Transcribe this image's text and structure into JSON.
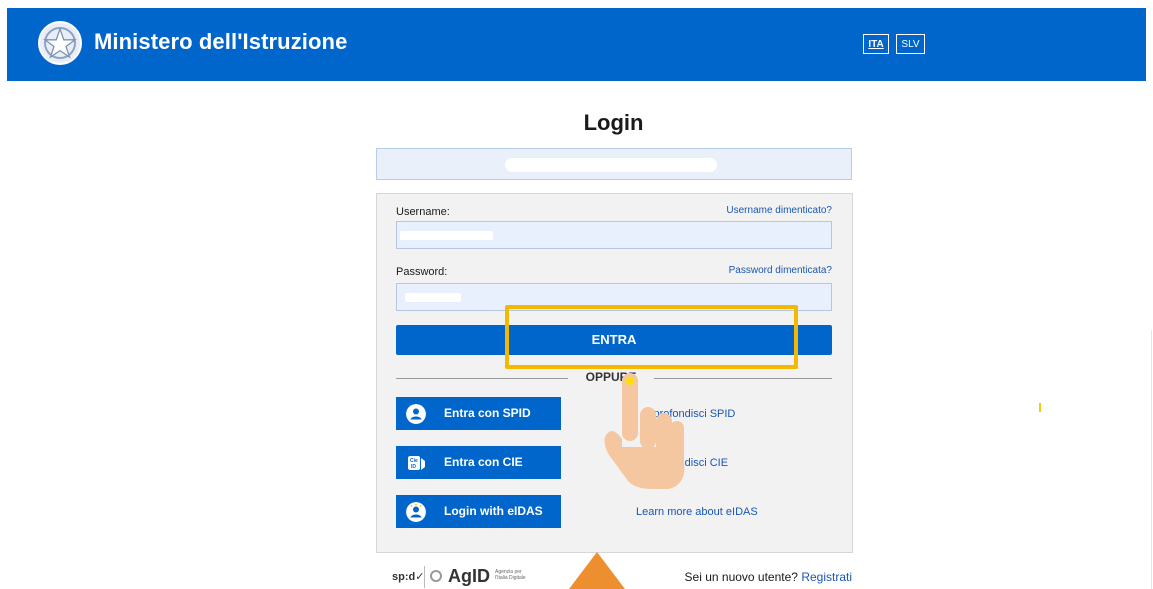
{
  "header": {
    "brand": "Ministero dell'Istruzione",
    "lang_ita": "ITA",
    "lang_slv": "SLV",
    "colors": {
      "bar": "#0066cc",
      "text": "#ffffff"
    }
  },
  "page_title": "Login",
  "form": {
    "username_label": "Username:",
    "username_forgot": "Username dimenticato?",
    "username_value": "",
    "password_label": "Password:",
    "password_forgot": "Password dimenticata?",
    "password_value": "",
    "submit_label": "ENTRA",
    "divider_text": "OPPURE"
  },
  "alternatives": [
    {
      "button": "Entra con SPID",
      "icon": "spid-user-icon",
      "info": "Approfondisci SPID"
    },
    {
      "button": "Entra con CIE",
      "icon": "cie-card-icon",
      "info": "Approfondisci CIE"
    },
    {
      "button": "Login with eIDAS",
      "icon": "eidas-user-icon",
      "info": "Learn more about eIDAS"
    }
  ],
  "footer": {
    "spid_logo": "sp:d✓",
    "agid_logo": "AgID",
    "agid_sub": "Agenzia per l'Italia Digitale",
    "new_user_text": "Sei un nuovo utente?",
    "register_link": "Registrati"
  },
  "accents": {
    "highlight": "#f5b800",
    "link": "#1a57b3",
    "hand": "#f5c7a0",
    "pointer": "#ee8f2f"
  }
}
